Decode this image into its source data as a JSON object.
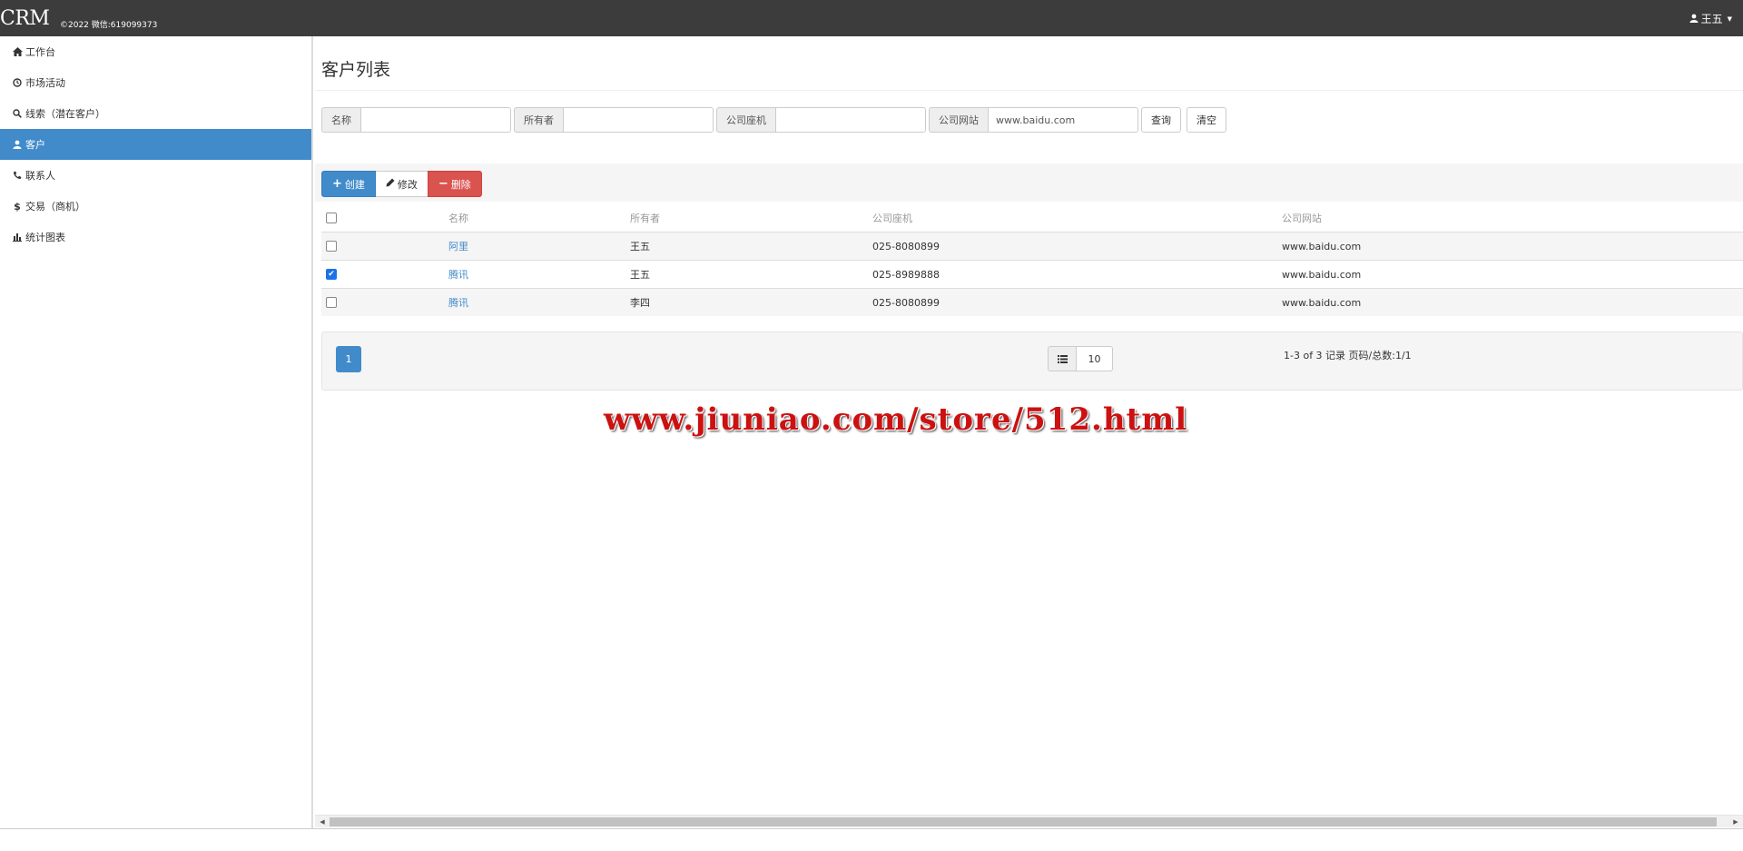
{
  "header": {
    "brand": "CRM",
    "copyright": "©2022 微信:619099373",
    "user": "王五"
  },
  "sidebar": {
    "items": [
      {
        "label": "工作台",
        "icon": "home-icon"
      },
      {
        "label": "市场活动",
        "icon": "clock-icon"
      },
      {
        "label": "线索（潜在客户）",
        "icon": "search-icon"
      },
      {
        "label": "客户",
        "icon": "user-icon",
        "active": true
      },
      {
        "label": "联系人",
        "icon": "phone-icon"
      },
      {
        "label": "交易（商机）",
        "icon": "dollar-icon"
      },
      {
        "label": "统计图表",
        "icon": "bar-chart-icon"
      }
    ]
  },
  "main": {
    "title": "客户列表",
    "search": {
      "name_label": "名称",
      "name_value": "",
      "owner_label": "所有者",
      "owner_value": "",
      "phone_label": "公司座机",
      "phone_value": "",
      "website_label": "公司网站",
      "website_value": "www.baidu.com",
      "query_label": "查询",
      "clear_label": "清空"
    },
    "toolbar": {
      "create_label": "创建",
      "edit_label": "修改",
      "delete_label": "删除"
    },
    "table": {
      "columns": [
        "名称",
        "所有者",
        "公司座机",
        "公司网站"
      ],
      "rows": [
        {
          "name": "阿里",
          "owner": "王五",
          "phone": "025-8080899",
          "website": "www.baidu.com",
          "checked": false
        },
        {
          "name": "腾讯",
          "owner": "王五",
          "phone": "025-8989888",
          "website": "www.baidu.com",
          "checked": true
        },
        {
          "name": "腾讯",
          "owner": "李四",
          "phone": "025-8080899",
          "website": "www.baidu.com",
          "checked": false
        }
      ]
    },
    "pagination": {
      "current": "1",
      "page_size": "10",
      "info": "1-3 of 3 记录 页码/总数:1/1"
    }
  },
  "watermark": "www.jiuniao.com/store/512.html",
  "colors": {
    "topbar": "#3c3c3c",
    "primary": "#428bca",
    "danger": "#d9534f",
    "watermark": "#cc1111"
  }
}
